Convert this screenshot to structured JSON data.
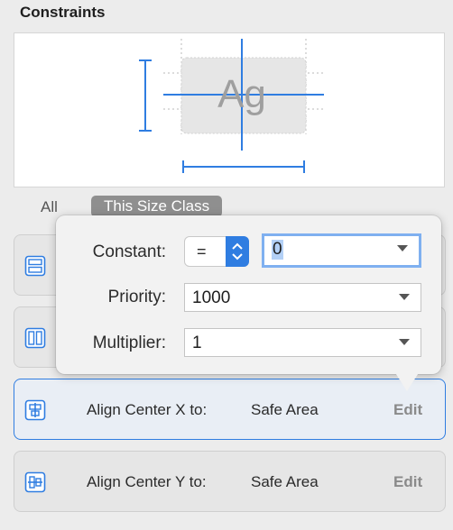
{
  "section": {
    "title": "Constraints"
  },
  "preview": {
    "sample_text": "Ag"
  },
  "tabs": {
    "all": "All",
    "size_class": "This Size Class"
  },
  "popover": {
    "constant_label": "Constant:",
    "relation": "=",
    "constant_value": "0",
    "priority_label": "Priority:",
    "priority_value": "1000",
    "multiplier_label": "Multiplier:",
    "multiplier_value": "1"
  },
  "rows": [
    {
      "label": "Align Center X to:",
      "value": "Safe Area",
      "action": "Edit"
    },
    {
      "label": "Align Center Y to:",
      "value": "Safe Area",
      "action": "Edit"
    }
  ],
  "colors": {
    "accent": "#2f7de1",
    "selection": "#b3d0f6"
  }
}
